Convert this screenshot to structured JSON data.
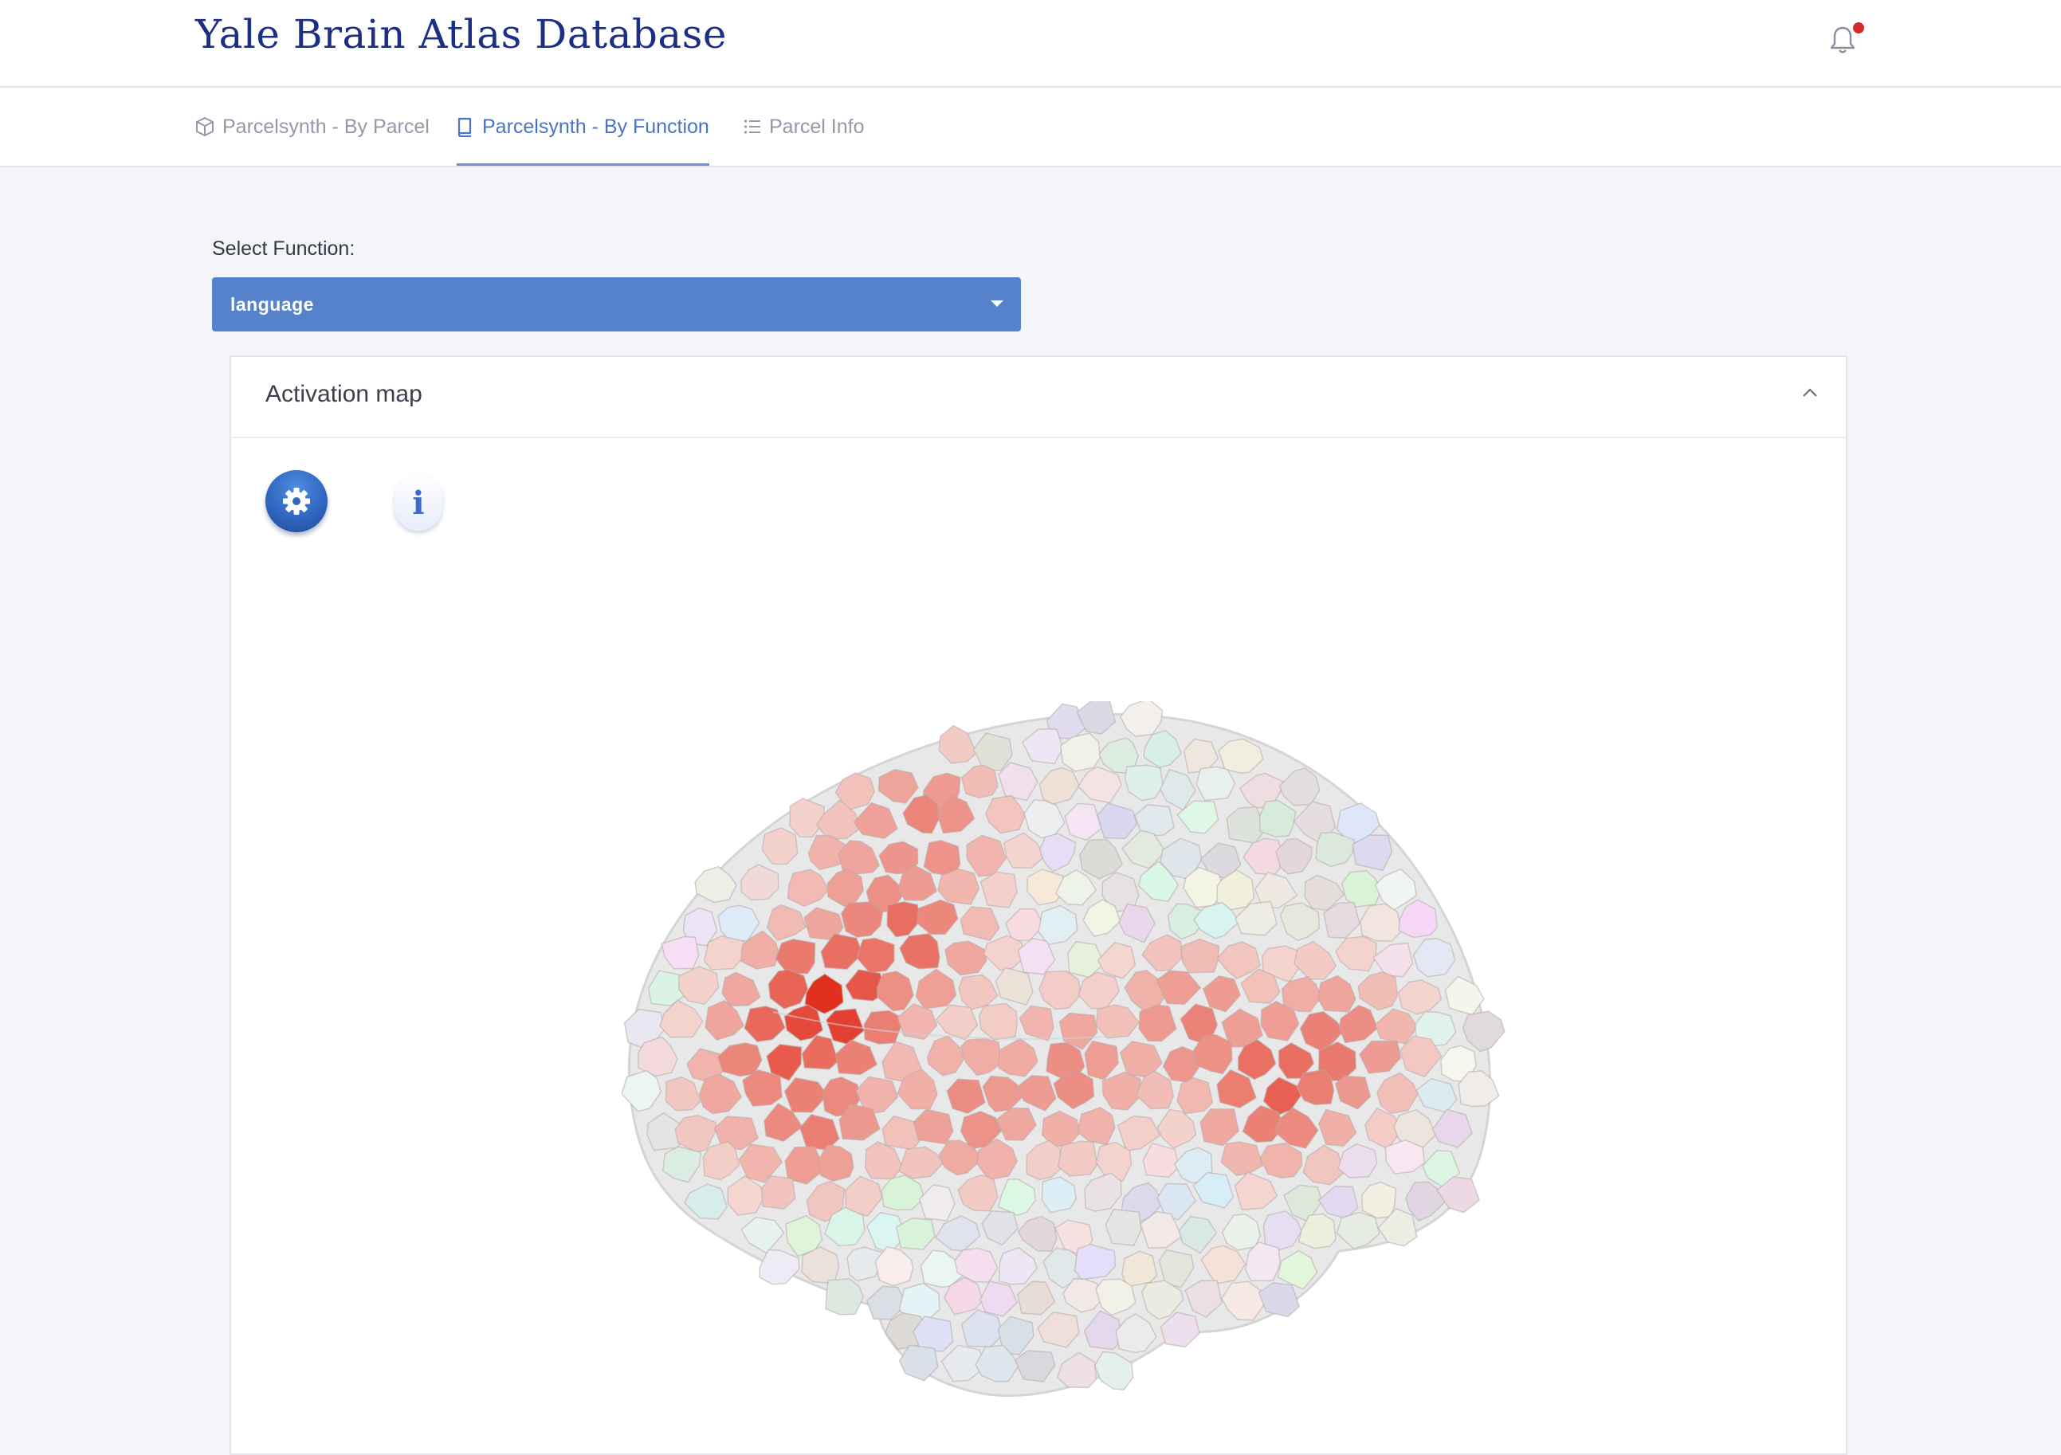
{
  "app": {
    "title": "Yale Brain Atlas Database"
  },
  "header": {
    "notification_icon": "bell-icon",
    "notification_dot_color": "#d42b2b"
  },
  "tabs": [
    {
      "label": "Parcelsynth - By Parcel",
      "icon": "cube-icon",
      "active": false
    },
    {
      "label": "Parcelsynth - By Function",
      "icon": "book-icon",
      "active": true
    },
    {
      "label": "Parcel Info",
      "icon": "list-icon",
      "active": false
    }
  ],
  "function_select": {
    "label": "Select Function:",
    "value": "language",
    "background": "#5681cb"
  },
  "panel": {
    "title": "Activation map",
    "collapse_icon": "chevron-up-icon",
    "settings_icon": "gear-icon",
    "info_icon": "info-icon",
    "info_glyph": "i",
    "viewer": "brain-3d-activation-map"
  },
  "colors": {
    "accent": "#4a73c6",
    "brand": "#1c2f85",
    "activation_high": "#e02a1c",
    "activation_low": "#f3e6e2",
    "inactive": "#dcdcdc"
  }
}
